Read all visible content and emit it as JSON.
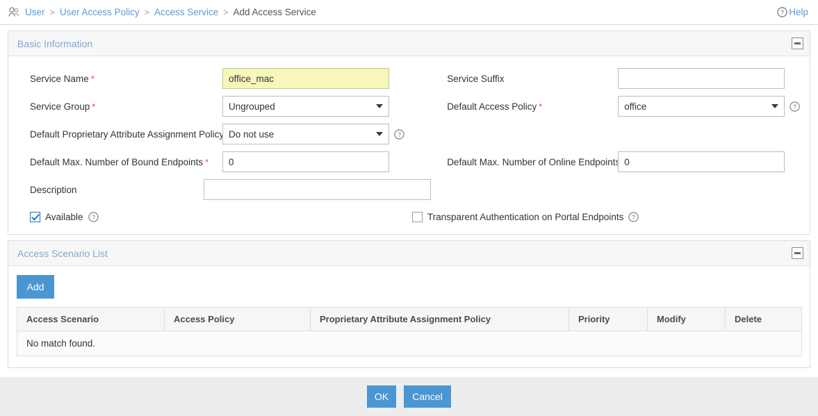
{
  "breadcrumb": {
    "icon": "users-icon",
    "items": [
      {
        "label": "User",
        "current": false
      },
      {
        "label": "User Access Policy",
        "current": false
      },
      {
        "label": "Access Service",
        "current": false
      },
      {
        "label": "Add Access Service",
        "current": true
      }
    ],
    "separator": ">",
    "help_label": "Help",
    "help_icon": "question-circle-icon"
  },
  "colors": {
    "link": "#5b9bd5",
    "panel_title": "#7fa9d3",
    "accent_button": "#4a96d2",
    "required_star": "#e8434f",
    "highlight_field": "#f7f7bc"
  },
  "basic_information": {
    "title": "Basic Information",
    "collapse_icon": "minus-square-icon",
    "fields": {
      "service_name": {
        "label": "Service Name",
        "required": "*",
        "value": "office_mac",
        "placeholder": ""
      },
      "service_suffix": {
        "label": "Service Suffix",
        "required": "",
        "value": "",
        "placeholder": ""
      },
      "service_group": {
        "label": "Service Group",
        "required": "*",
        "value": "Ungrouped"
      },
      "default_access_policy": {
        "label": "Default Access Policy",
        "required": "*",
        "value": "office"
      },
      "default_proprietary_policy": {
        "label": "Default Proprietary Attribute Assignment Policy",
        "required": "*",
        "value": "Do not use"
      },
      "max_bound_endpoints": {
        "label": "Default Max. Number of Bound Endpoints",
        "required": "*",
        "value": "0",
        "placeholder": ""
      },
      "max_online_endpoints": {
        "label": "Default Max. Number of Online Endpoints",
        "required": "*",
        "value": "0",
        "placeholder": ""
      },
      "description": {
        "label": "Description",
        "required": "",
        "value": "",
        "placeholder": ""
      },
      "available": {
        "label": "Available",
        "checked": true
      },
      "transparent_auth": {
        "label": "Transparent Authentication on Portal Endpoints",
        "checked": false
      }
    }
  },
  "access_scenario_list": {
    "title": "Access Scenario List",
    "collapse_icon": "minus-square-icon",
    "add_label": "Add",
    "columns": [
      "Access Scenario",
      "Access Policy",
      "Proprietary Attribute Assignment Policy",
      "Priority",
      "Modify",
      "Delete"
    ],
    "rows": [],
    "empty_message": "No match found."
  },
  "footer": {
    "ok_label": "OK",
    "cancel_label": "Cancel"
  }
}
